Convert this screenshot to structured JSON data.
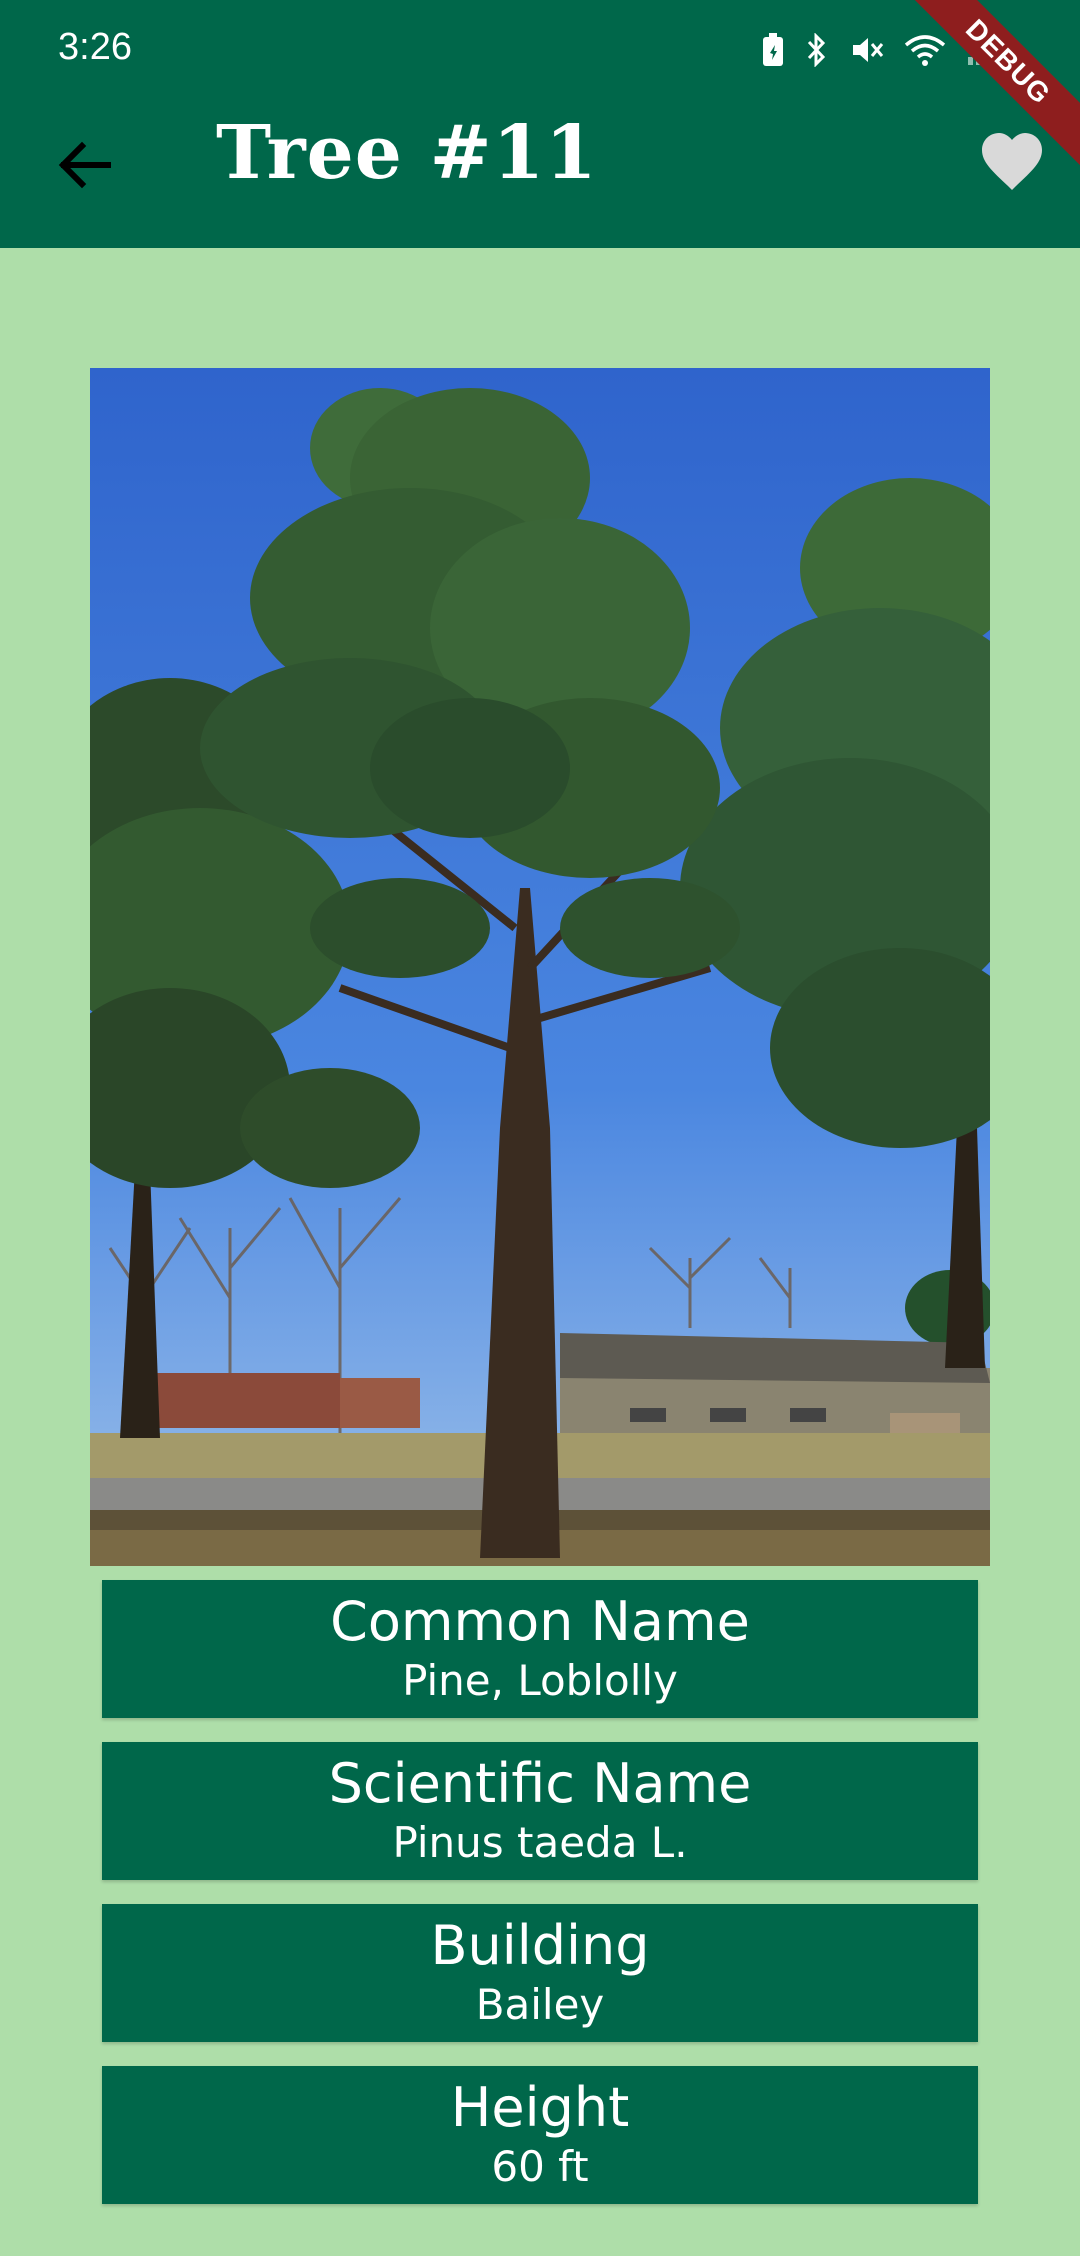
{
  "status_bar": {
    "time": "3:26",
    "icons": [
      "battery-saver-icon",
      "bluetooth-icon",
      "mute-icon",
      "wifi-icon",
      "signal-icon"
    ]
  },
  "debug_banner": "DEBUG",
  "app_bar": {
    "back_icon": "arrow-back-icon",
    "title": "Tree #11",
    "favorite_icon": "heart-icon"
  },
  "colors": {
    "app_bar": "#00674a",
    "background": "#aedea9",
    "card": "#00674a",
    "text": "#ffffff",
    "heart": "#d9d9d9"
  },
  "details": [
    {
      "label": "Common Name",
      "value": "Pine, Loblolly"
    },
    {
      "label": "Scientific Name",
      "value": "Pinus taeda L."
    },
    {
      "label": "Building",
      "value": "Bailey"
    },
    {
      "label": "Height",
      "value": "60 ft"
    }
  ]
}
